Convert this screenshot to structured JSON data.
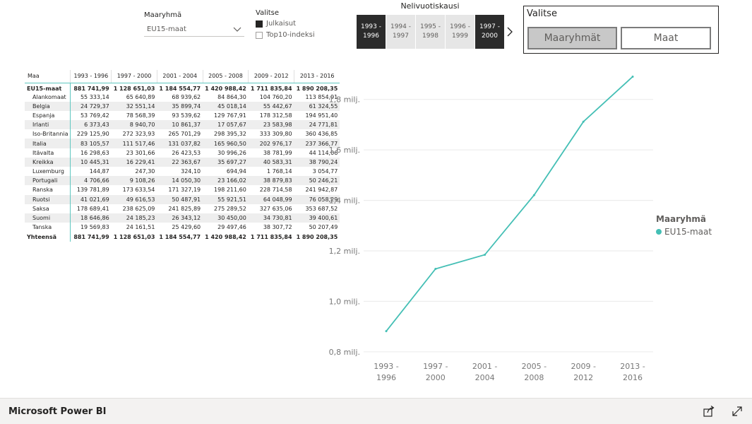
{
  "slicer_group": {
    "label": "Maaryhmä",
    "value": "EU15-maat"
  },
  "slicer_select": {
    "label": "Valitse",
    "options": [
      {
        "label": "Julkaisut",
        "checked": true
      },
      {
        "label": "Top10-indeksi",
        "checked": false
      }
    ]
  },
  "period_slicer": {
    "title": "Nelivuotiskausi",
    "tiles": [
      {
        "top": "1993 -",
        "bottom": "1996",
        "selected": true
      },
      {
        "top": "1994 -",
        "bottom": "1997",
        "selected": false
      },
      {
        "top": "1995 -",
        "bottom": "1998",
        "selected": false
      },
      {
        "top": "1996 -",
        "bottom": "1999",
        "selected": false
      },
      {
        "top": "1997 -",
        "bottom": "2000",
        "selected": true
      }
    ]
  },
  "select_box": {
    "title": "Valitse",
    "buttons": [
      {
        "label": "Maaryhmät",
        "active": true
      },
      {
        "label": "Maat",
        "active": false
      }
    ]
  },
  "matrix": {
    "headers": [
      "Maa",
      "1993 - 1996",
      "1997 - 2000",
      "2001 - 2004",
      "2005 - 2008",
      "2009 - 2012",
      "2013 - 2016"
    ],
    "group_row": {
      "name": "EU15-maat",
      "values": [
        "881 741,99",
        "1 128 651,03",
        "1 184 554,77",
        "1 420 988,42",
        "1 711 835,84",
        "1 890 208,35"
      ]
    },
    "rows": [
      {
        "name": "Alankomaat",
        "values": [
          "55 333,14",
          "65 640,89",
          "68 939,62",
          "84 864,30",
          "104 760,20",
          "113 854,91"
        ]
      },
      {
        "name": "Belgia",
        "values": [
          "24 729,37",
          "32 551,14",
          "35 899,74",
          "45 018,14",
          "55 442,67",
          "61 324,55"
        ]
      },
      {
        "name": "Espanja",
        "values": [
          "53 769,42",
          "78 568,39",
          "93 539,62",
          "129 767,91",
          "178 312,58",
          "194 951,40"
        ]
      },
      {
        "name": "Irlanti",
        "values": [
          "6 373,43",
          "8 940,70",
          "10 861,37",
          "17 057,67",
          "23 583,98",
          "24 771,81"
        ]
      },
      {
        "name": "Iso-Britannia",
        "values": [
          "229 125,90",
          "272 323,93",
          "265 701,29",
          "298 395,32",
          "333 309,80",
          "360 436,85"
        ]
      },
      {
        "name": "Italia",
        "values": [
          "83 105,57",
          "111 517,46",
          "131 037,82",
          "165 960,50",
          "202 976,17",
          "237 366,77"
        ]
      },
      {
        "name": "Itävalta",
        "values": [
          "16 298,63",
          "23 301,66",
          "26 423,53",
          "30 996,26",
          "38 781,99",
          "44 114,06"
        ]
      },
      {
        "name": "Kreikka",
        "values": [
          "10 445,31",
          "16 229,41",
          "22 363,67",
          "35 697,27",
          "40 583,31",
          "38 790,24"
        ]
      },
      {
        "name": "Luxemburg",
        "values": [
          "144,87",
          "247,30",
          "324,10",
          "694,94",
          "1 768,14",
          "3 054,77"
        ]
      },
      {
        "name": "Portugali",
        "values": [
          "4 706,66",
          "9 108,26",
          "14 050,30",
          "23 166,02",
          "38 879,83",
          "50 246,21"
        ]
      },
      {
        "name": "Ranska",
        "values": [
          "139 781,89",
          "173 633,54",
          "171 327,19",
          "198 211,60",
          "228 714,58",
          "241 942,87"
        ]
      },
      {
        "name": "Ruotsi",
        "values": [
          "41 021,69",
          "49 616,53",
          "50 487,91",
          "55 921,51",
          "64 048,99",
          "76 058,29"
        ]
      },
      {
        "name": "Saksa",
        "values": [
          "178 689,41",
          "238 625,09",
          "241 825,89",
          "275 289,52",
          "327 635,06",
          "353 687,52"
        ]
      },
      {
        "name": "Suomi",
        "values": [
          "18 646,86",
          "24 185,23",
          "26 343,12",
          "30 450,00",
          "34 730,81",
          "39 400,61"
        ]
      },
      {
        "name": "Tanska",
        "values": [
          "19 569,83",
          "24 161,51",
          "25 429,60",
          "29 497,46",
          "38 307,72",
          "50 207,49"
        ]
      }
    ],
    "total_row": {
      "name": "Yhteensä",
      "values": [
        "881 741,99",
        "1 128 651,03",
        "1 184 554,77",
        "1 420 988,42",
        "1 711 835,84",
        "1 890 208,35"
      ]
    }
  },
  "chart_data": {
    "type": "line",
    "categories": [
      "1993 - 1996",
      "1997 - 2000",
      "2001 - 2004",
      "2005 - 2008",
      "2009 - 2012",
      "2013 - 2016"
    ],
    "series": [
      {
        "name": "EU15-maat",
        "color": "#44bfb5",
        "values": [
          881741.99,
          1128651.03,
          1184554.77,
          1420988.42,
          1711835.84,
          1890208.35
        ]
      }
    ],
    "ylim": [
      780000,
      1900000
    ],
    "yticks": [
      800000,
      1000000,
      1200000,
      1400000,
      1600000,
      1800000
    ],
    "ytick_labels": [
      "0,8 milj.",
      "1,0 milj.",
      "1,2 milj.",
      "1,4 milj.",
      "1,6 milj.",
      "1,8 milj."
    ],
    "xtick_labels": [
      [
        "1993 -",
        "1996"
      ],
      [
        "1997 -",
        "2000"
      ],
      [
        "2001 -",
        "2004"
      ],
      [
        "2005 -",
        "2008"
      ],
      [
        "2009 -",
        "2012"
      ],
      [
        "2013 -",
        "2016"
      ]
    ],
    "grid": true,
    "legend": {
      "title": "Maaryhmä",
      "placement": "right"
    }
  },
  "footer": {
    "brand": "Microsoft Power BI",
    "icons": [
      "share-icon",
      "fullscreen-icon"
    ]
  },
  "colors": {
    "accent": "#44bfb5",
    "tile_selected": "#2b2b2b",
    "tile": "#e6e6e6"
  }
}
